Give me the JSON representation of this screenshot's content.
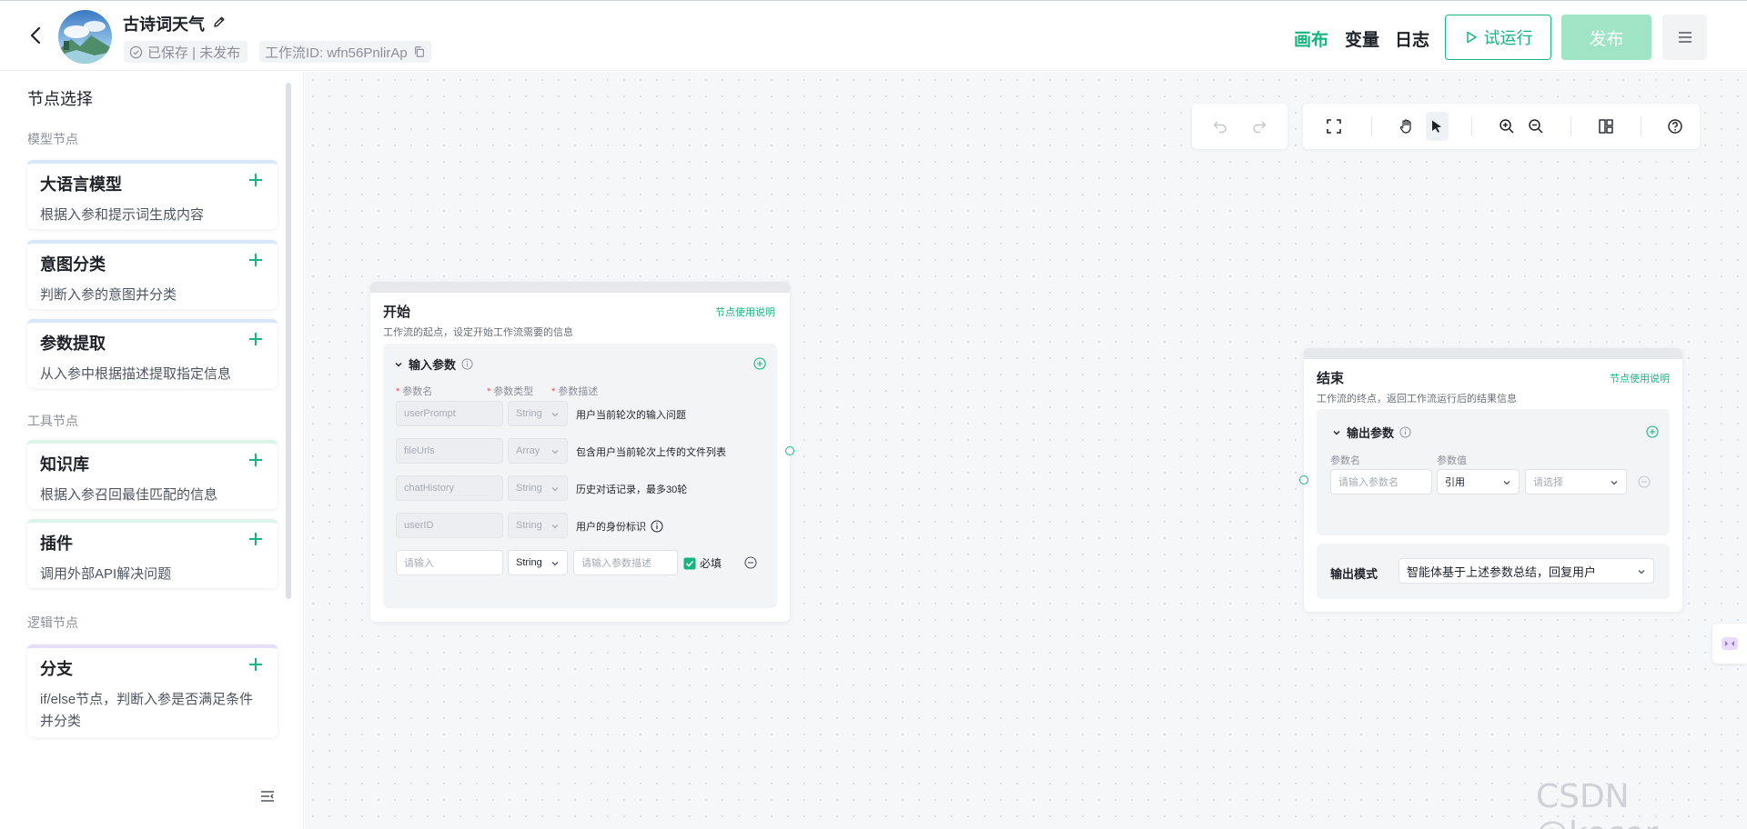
{
  "header": {
    "app_title": "古诗词天气",
    "status": "已保存 | 未发布",
    "workflow_id": "工作流ID: wfn56PnlirAp",
    "tabs": [
      {
        "label": "画布",
        "active": true
      },
      {
        "label": "变量",
        "active": false
      },
      {
        "label": "日志",
        "active": false
      }
    ],
    "run_label": "试运行",
    "publish_label": "发布",
    "accent_color": "#16b57f"
  },
  "sidebar": {
    "title": "节点选择",
    "sections": [
      {
        "label": "模型节点",
        "items": [
          {
            "title": "大语言模型",
            "desc": "根据入参和提示词生成内容"
          },
          {
            "title": "意图分类",
            "desc": "判断入参的意图并分类"
          },
          {
            "title": "参数提取",
            "desc": "从入参中根据描述提取指定信息"
          }
        ]
      },
      {
        "label": "工具节点",
        "items": [
          {
            "title": "知识库",
            "desc": "根据入参召回最佳匹配的信息"
          },
          {
            "title": "插件",
            "desc": "调用外部API解决问题"
          }
        ]
      },
      {
        "label": "逻辑节点",
        "items": [
          {
            "title": "分支",
            "desc": "if/else节点，判断入参是否满足条件并分类"
          }
        ]
      }
    ]
  },
  "start_node": {
    "title": "开始",
    "help_link": "节点使用说明",
    "desc": "工作流的起点，设定开始工作流需要的信息",
    "panel_title": "输入参数",
    "columns": [
      "参数名",
      "参数类型",
      "参数描述"
    ],
    "params": [
      {
        "name": "userPrompt",
        "type": "String",
        "desc": "用户当前轮次的输入问题"
      },
      {
        "name": "fileUrls",
        "type": "Array",
        "desc": "包含用户当前轮次上传的文件列表"
      },
      {
        "name": "chatHistory",
        "type": "String",
        "desc": "历史对话记录，最多30轮"
      },
      {
        "name": "userID",
        "type": "String",
        "desc": "用户的身份标识"
      }
    ],
    "new_row": {
      "name_placeholder": "请输入",
      "type": "String",
      "desc_placeholder": "请输入参数描述",
      "required_label": "必填"
    }
  },
  "end_node": {
    "title": "结束",
    "help_link": "节点使用说明",
    "desc": "工作流的终点，返回工作流运行后的结果信息",
    "panel_title": "输出参数",
    "columns": [
      "参数名",
      "参数值"
    ],
    "name_placeholder": "请输入参数名",
    "value_type": "引用",
    "value_placeholder": "请选择",
    "output_mode_label": "输出模式",
    "output_mode_value": "智能体基于上述参数总结，回复用户"
  },
  "watermark": "CSDN @kocor"
}
